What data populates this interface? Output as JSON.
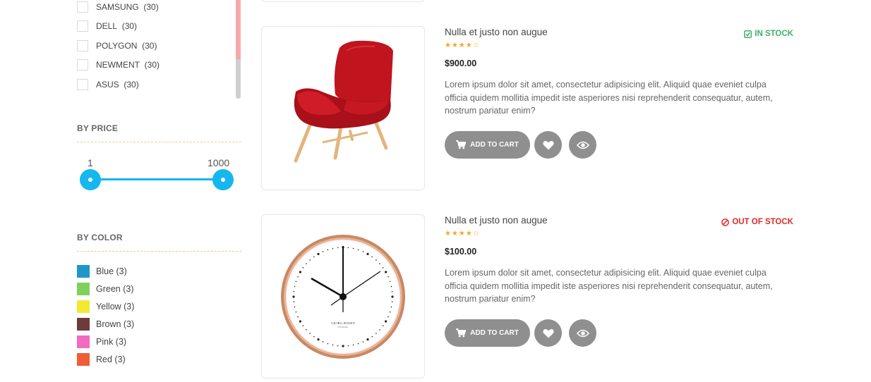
{
  "brands": [
    {
      "name": "SAMSUNG",
      "count": "(30)"
    },
    {
      "name": "DELL",
      "count": "(30)"
    },
    {
      "name": "POLYGON",
      "count": "(30)"
    },
    {
      "name": "NEWMENT",
      "count": "(30)"
    },
    {
      "name": "ASUS",
      "count": "(30)"
    }
  ],
  "price_filter": {
    "title": "BY PRICE",
    "min": "1",
    "max": "1000",
    "range_min_value": 1,
    "range_max_value": 1000
  },
  "color_filter": {
    "title": "BY COLOR",
    "colors": [
      {
        "label": "Blue (3)",
        "hex": "#1f97c9"
      },
      {
        "label": "Green (3)",
        "hex": "#7fd05c"
      },
      {
        "label": "Yellow (3)",
        "hex": "#f1ea34"
      },
      {
        "label": "Brown (3)",
        "hex": "#6e3a3a"
      },
      {
        "label": "Pink (3)",
        "hex": "#f36bbf"
      },
      {
        "label": "Red (3)",
        "hex": "#f15c38"
      }
    ]
  },
  "products": [
    {
      "name": "Nulla et justo non augue",
      "rating": "★★★★☆",
      "price": "$900.00",
      "stock": "IN STOCK",
      "stock_status": "in",
      "description": "Lorem ipsum dolor sit amet, consectetur adipisicing elit. Aliquid quae eveniet culpa officia quidem mollitia impedit iste asperiores nisi reprehenderit consequatur, autem, nostrum pariatur enim?",
      "add_to_cart": "ADD TO CART",
      "image": "red-armchair"
    },
    {
      "name": "Nulla et justo non augue",
      "rating": "★★★★☆",
      "price": "$100.00",
      "stock": "OUT OF STOCK",
      "stock_status": "out",
      "description": "Lorem ipsum dolor sit amet, consectetur adipisicing elit. Aliquid quae eveniet culpa officia quidem mollitia impedit iste asperiores nisi reprehenderit consequatur, autem, nostrum pariatur enim?",
      "add_to_cart": "ADD TO CART",
      "image": "wall-clock",
      "clock_brand": "GEORG JENSEN",
      "clock_sub": "DENMARK"
    }
  ],
  "icons": {
    "cart": "cart-icon",
    "wishlist": "heart-icon",
    "quick_view": "eye-icon",
    "in_stock": "check-square-icon",
    "out_of_stock": "ban-icon"
  },
  "colors": {
    "accent": "#15b7ef",
    "button": "#8f8f8f",
    "in_stock": "#3db16b",
    "out_of_stock": "#e6282b",
    "star": "#f5a623"
  }
}
